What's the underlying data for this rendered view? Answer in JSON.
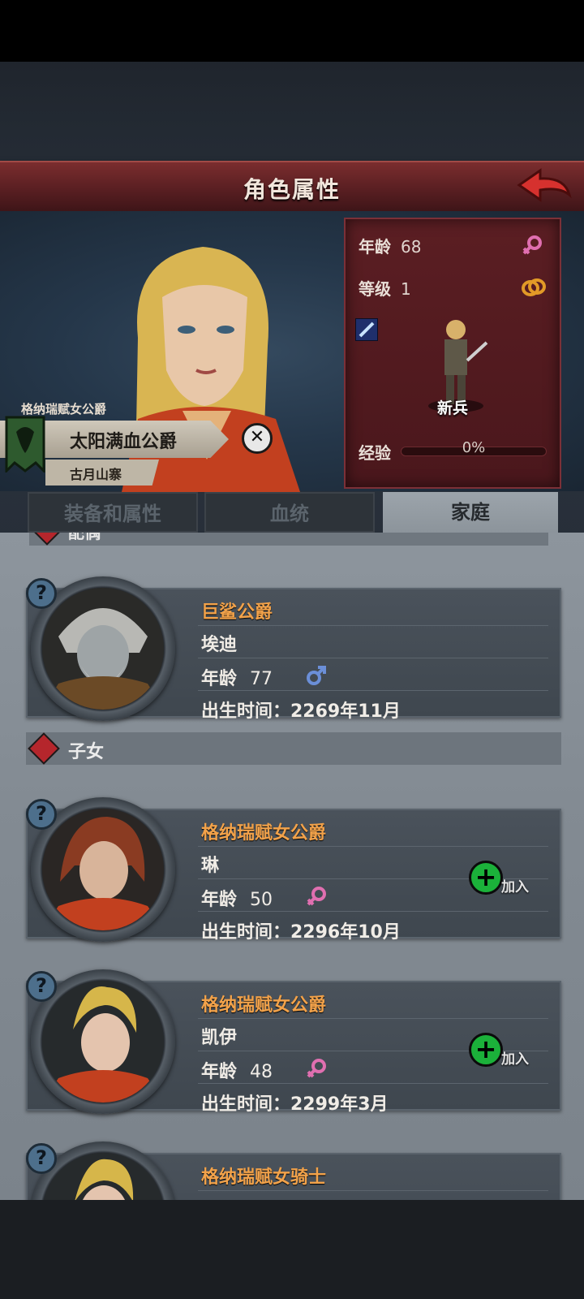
{
  "header": {
    "title": "角色属性"
  },
  "character": {
    "noble_title": "格纳瑞赋女公爵",
    "name": "太阳满血公爵",
    "settlement": "古月山寨",
    "stats": {
      "age_label": "年龄",
      "age": "68",
      "level_label": "等级",
      "level": "1",
      "unit": "新兵",
      "exp_label": "经验",
      "exp": "0%",
      "exp_fraction": 0
    }
  },
  "tabs": [
    {
      "label": "装备和属性",
      "active": false
    },
    {
      "label": "血统",
      "active": false
    },
    {
      "label": "家庭",
      "active": true
    }
  ],
  "family": {
    "spouse_section": "配偶",
    "spouse": {
      "title": "巨鲨公爵",
      "name": "埃迪",
      "age_label": "年龄",
      "age": "77",
      "gender": "male",
      "birth": "出生时间：2269年11月"
    },
    "children_section": "子女",
    "children": [
      {
        "title": "格纳瑞赋女公爵",
        "name": "琳",
        "age_label": "年龄",
        "age": "50",
        "gender": "female",
        "birth": "出生时间：2296年10月",
        "join": "加入"
      },
      {
        "title": "格纳瑞赋女公爵",
        "name": "凯伊",
        "age_label": "年龄",
        "age": "48",
        "gender": "female",
        "birth": "出生时间：2299年3月",
        "join": "加入"
      },
      {
        "title": "格纳瑞赋女骑士"
      }
    ]
  },
  "icons": {
    "back": "back-arrow-icon",
    "female": "female-icon",
    "male": "male-icon",
    "ring": "ring-icon",
    "sword": "sword-icon",
    "help": "question-icon",
    "close": "close-icon",
    "add": "plus-icon"
  },
  "help_glyph": "?",
  "close_glyph": "✕",
  "plus_glyph": "+"
}
